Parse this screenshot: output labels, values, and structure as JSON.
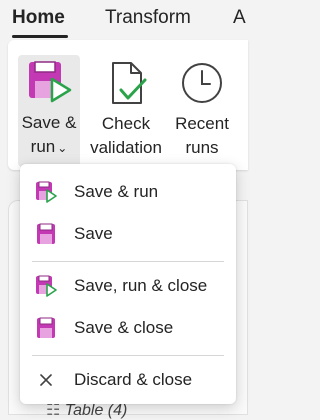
{
  "tabs": [
    {
      "label": "Home",
      "active": true
    },
    {
      "label": "Transform",
      "active": false
    },
    {
      "label": "A",
      "active": false
    }
  ],
  "ribbon": {
    "save_run": {
      "line1": "Save &",
      "line2": "run"
    },
    "check_validation": {
      "line1": "Check",
      "line2": "validation"
    },
    "recent_runs": {
      "line1": "Recent",
      "line2": "runs"
    }
  },
  "menu": {
    "items": [
      {
        "label": "Save & run",
        "icon": "save-run-icon"
      },
      {
        "label": "Save",
        "icon": "save-icon"
      },
      {
        "label": "Save, run & close",
        "icon": "save-run-icon"
      },
      {
        "label": "Save & close",
        "icon": "save-icon"
      },
      {
        "label": "Discard & close",
        "icon": "close-icon"
      }
    ]
  },
  "background": {
    "row_label": "Table (4)"
  },
  "colors": {
    "accent_purple": "#c239b3",
    "accent_green": "#2aa34a"
  }
}
